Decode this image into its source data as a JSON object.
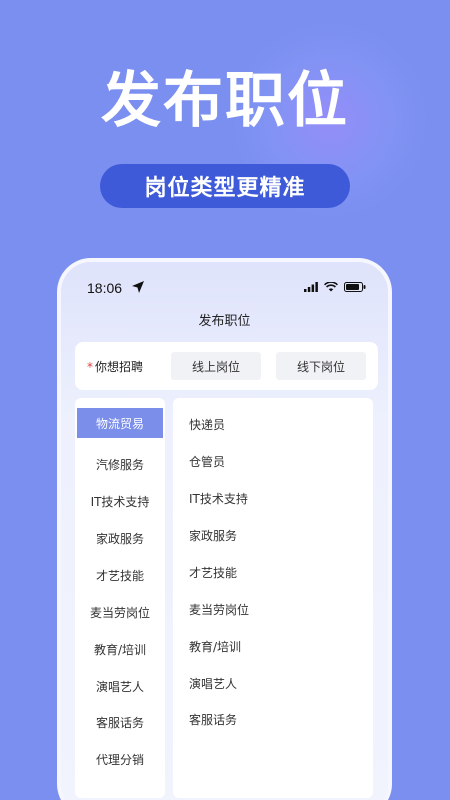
{
  "hero": {
    "title": "发布职位",
    "subtitle": "岗位类型更精准"
  },
  "status_bar": {
    "time": "18:06",
    "icons": [
      "location-arrow-icon",
      "signal-icon",
      "wifi-icon",
      "battery-icon"
    ]
  },
  "page": {
    "title": "发布职位"
  },
  "want": {
    "required_mark": "*",
    "label": "你想招聘",
    "options": [
      "线上岗位",
      "线下岗位"
    ]
  },
  "categories": [
    {
      "label": "物流贸易",
      "active": true
    },
    {
      "label": "汽修服务",
      "active": false
    },
    {
      "label": "IT技术支持",
      "active": false
    },
    {
      "label": "家政服务",
      "active": false
    },
    {
      "label": "才艺技能",
      "active": false
    },
    {
      "label": "麦当劳岗位",
      "active": false
    },
    {
      "label": "教育/培训",
      "active": false
    },
    {
      "label": "演唱艺人",
      "active": false
    },
    {
      "label": "客服话务",
      "active": false
    },
    {
      "label": "代理分销",
      "active": false
    }
  ],
  "jobs": [
    "快递员",
    "仓管员",
    "IT技术支持",
    "家政服务",
    "才艺技能",
    "麦当劳岗位",
    "教育/培训",
    "演唱艺人",
    "客服话务"
  ],
  "colors": {
    "background": "#7a8ff0",
    "pill": "#3f5ad8",
    "active_category": "#7b8ee9",
    "required_mark": "#e34040"
  }
}
